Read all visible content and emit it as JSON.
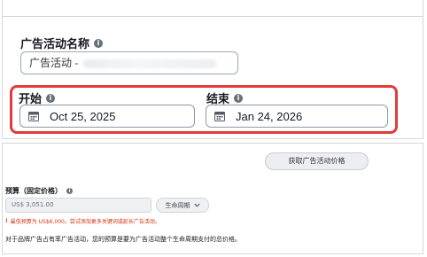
{
  "campaign_name": {
    "label": "广告活动名称",
    "value": "广告活动 -"
  },
  "dates": {
    "start_label": "开始",
    "start_value": "Oct 25, 2025",
    "end_label": "结束",
    "end_value": "Jan 24, 2026"
  },
  "pricing": {
    "button_label": "获取广告活动价格"
  },
  "budget": {
    "label": "预算（固定价格）",
    "value": "US$  3,051.00",
    "period": "生命周期",
    "warning": "最低预算为 US$6,000。尝试添加更多关键词或延长广告活动。",
    "helper": "对于品牌广告占有率广告活动，您的预算是要为广告活动整个生命周期支付的总价格。"
  },
  "colors": {
    "highlight": "#e33b3b",
    "warning": "#d13212"
  }
}
